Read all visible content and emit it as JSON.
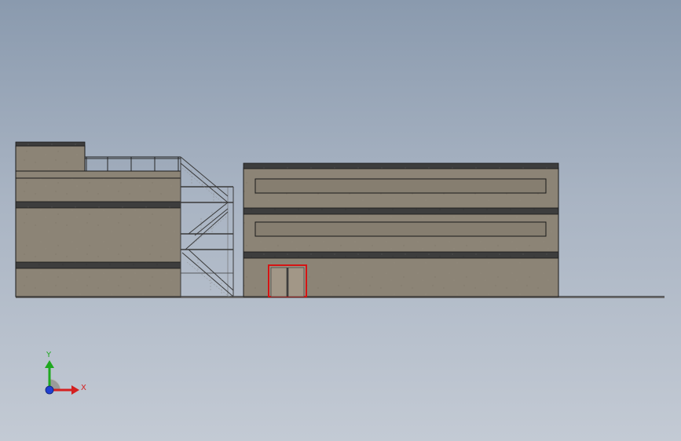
{
  "viewport": {
    "background_top": "#8a9aae",
    "background_bottom": "#c3cad4"
  },
  "model": {
    "wall_color": "#8c8476",
    "band_color": "#3d3d3d",
    "outline_color": "#1a1a1a",
    "door_frame_color": "#d41414",
    "stair_color": "#4a4a4a"
  },
  "triad": {
    "y_label": "Y",
    "x_label": "X",
    "y_color": "#1fa81f",
    "x_color": "#d42020",
    "z_color": "#2040d0"
  }
}
